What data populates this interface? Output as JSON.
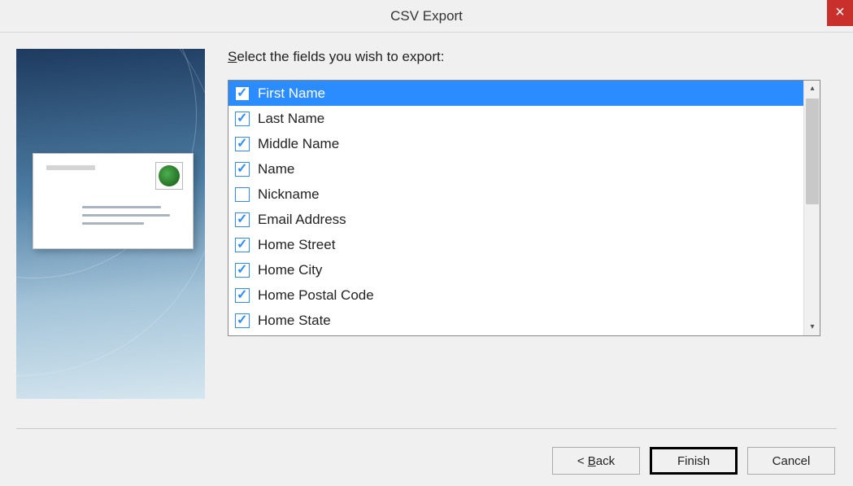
{
  "title": "CSV Export",
  "instruction_prefix": "S",
  "instruction_rest": "elect the fields you wish to export:",
  "fields": [
    {
      "label": "First Name",
      "checked": true,
      "selected": true
    },
    {
      "label": "Last Name",
      "checked": true,
      "selected": false
    },
    {
      "label": "Middle Name",
      "checked": true,
      "selected": false
    },
    {
      "label": "Name",
      "checked": true,
      "selected": false
    },
    {
      "label": "Nickname",
      "checked": false,
      "selected": false
    },
    {
      "label": "Email Address",
      "checked": true,
      "selected": false
    },
    {
      "label": "Home Street",
      "checked": true,
      "selected": false
    },
    {
      "label": "Home City",
      "checked": true,
      "selected": false
    },
    {
      "label": "Home Postal Code",
      "checked": true,
      "selected": false
    },
    {
      "label": "Home State",
      "checked": true,
      "selected": false
    }
  ],
  "buttons": {
    "back_prefix": "< ",
    "back_u": "B",
    "back_rest": "ack",
    "finish": "Finish",
    "cancel": "Cancel"
  }
}
